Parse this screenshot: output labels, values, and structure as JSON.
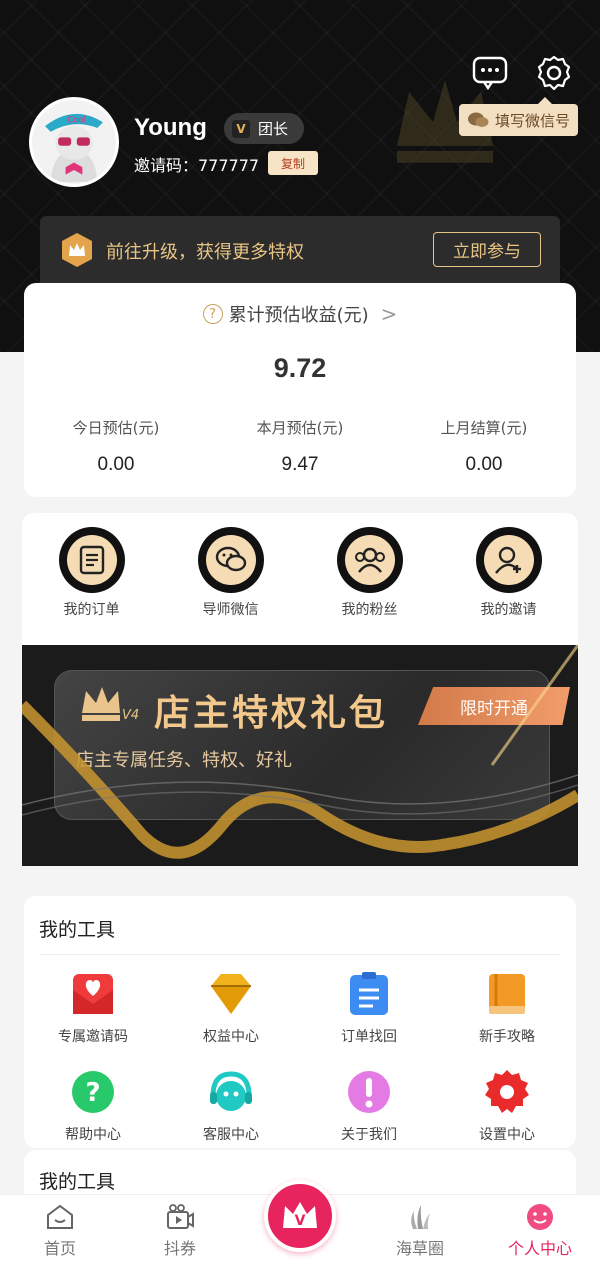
{
  "header": {
    "username": "Young",
    "role_badge": "团长",
    "invite_label": "邀请码：777777",
    "copy_label": "复制",
    "wechat_tip": "填写微信号"
  },
  "upgrade": {
    "text": "前往升级，获得更多特权",
    "button": "立即参与"
  },
  "earnings": {
    "title": "累计预估收益(元)",
    "total": "9.72",
    "columns": [
      {
        "label": "今日预估(元)",
        "value": "0.00"
      },
      {
        "label": "本月预估(元)",
        "value": "9.47"
      },
      {
        "label": "上月结算(元)",
        "value": "0.00"
      }
    ]
  },
  "menu": {
    "items": [
      {
        "label": "我的订单",
        "icon": "order-icon"
      },
      {
        "label": "导师微信",
        "icon": "wechat-icon"
      },
      {
        "label": "我的粉丝",
        "icon": "fans-icon"
      },
      {
        "label": "我的邀请",
        "icon": "invite-icon"
      }
    ]
  },
  "banner": {
    "badge": "V4",
    "title": "店主特权礼包",
    "subtitle": "店主专属任务、特权、好礼",
    "tag": "限时开通"
  },
  "tools": {
    "title": "我的工具",
    "items": [
      {
        "label": "专属邀请码",
        "icon": "invite-code-icon",
        "color": "#ef3b3b"
      },
      {
        "label": "权益中心",
        "icon": "diamond-icon",
        "color": "#f2b21b"
      },
      {
        "label": "订单找回",
        "icon": "clipboard-icon",
        "color": "#3d8cf2"
      },
      {
        "label": "新手攻略",
        "icon": "book-icon",
        "color": "#f39a26"
      },
      {
        "label": "帮助中心",
        "icon": "help-icon",
        "color": "#27c96b"
      },
      {
        "label": "客服中心",
        "icon": "headset-icon",
        "color": "#20c9c4"
      },
      {
        "label": "关于我们",
        "icon": "info-icon",
        "color": "#d85bd8"
      },
      {
        "label": "设置中心",
        "icon": "gear-icon",
        "color": "#ea2b2b"
      }
    ]
  },
  "tools2": {
    "title": "我的工具"
  },
  "tabbar": {
    "items": [
      {
        "label": "首页",
        "icon": "home-icon"
      },
      {
        "label": "抖券",
        "icon": "video-icon"
      },
      {
        "label": "海草圈",
        "icon": "seaweed-icon"
      },
      {
        "label": "个人中心",
        "icon": "profile-icon"
      }
    ],
    "center_icon": "v-crown-icon"
  },
  "colors": {
    "accent": "#e8245e",
    "gold": "#e8c585",
    "dark": "#101010"
  }
}
